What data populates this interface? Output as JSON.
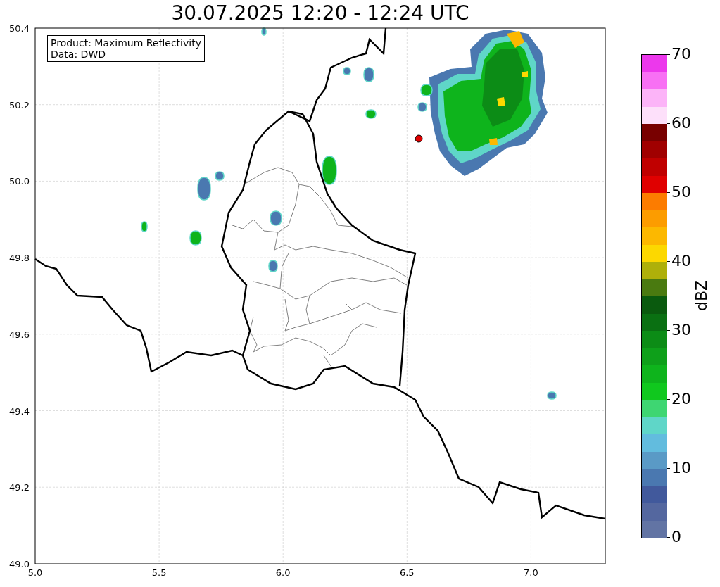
{
  "title": "30.07.2025 12:20 - 12:24 UTC",
  "info_box": {
    "lines": [
      "Product: Maximum Reflectivity",
      "Data: DWD"
    ]
  },
  "map": {
    "x_ticks": [
      "5.0",
      "5.5",
      "6.0",
      "6.5",
      "7.0"
    ],
    "y_ticks": [
      "50.4",
      "50.2",
      "50.0",
      "49.8",
      "49.6",
      "49.4",
      "49.2",
      "49.0"
    ]
  },
  "colorbar": {
    "label": "dBZ",
    "ticks": [
      "70",
      "60",
      "50",
      "40",
      "30",
      "20",
      "10",
      "0"
    ],
    "segments": [
      {
        "color": "#6274a4"
      },
      {
        "color": "#54679f"
      },
      {
        "color": "#41599c"
      },
      {
        "color": "#4a78b0"
      },
      {
        "color": "#5a9ac6"
      },
      {
        "color": "#62bcde"
      },
      {
        "color": "#5fd6c8"
      },
      {
        "color": "#3ed672"
      },
      {
        "color": "#10c81e"
      },
      {
        "color": "#0eb41c"
      },
      {
        "color": "#0ea01a"
      },
      {
        "color": "#0c8c16"
      },
      {
        "color": "#0a7012"
      },
      {
        "color": "#0a5a0e"
      },
      {
        "color": "#4a7a10"
      },
      {
        "color": "#aeb00a"
      },
      {
        "color": "#fcd800"
      },
      {
        "color": "#fcb800"
      },
      {
        "color": "#fc9c00"
      },
      {
        "color": "#fc7c00"
      },
      {
        "color": "#e00000"
      },
      {
        "color": "#c00000"
      },
      {
        "color": "#a00000"
      },
      {
        "color": "#780000"
      },
      {
        "color": "#fde0fa"
      },
      {
        "color": "#fcb4f8"
      },
      {
        "color": "#f870f4"
      },
      {
        "color": "#ec38ec"
      }
    ]
  }
}
